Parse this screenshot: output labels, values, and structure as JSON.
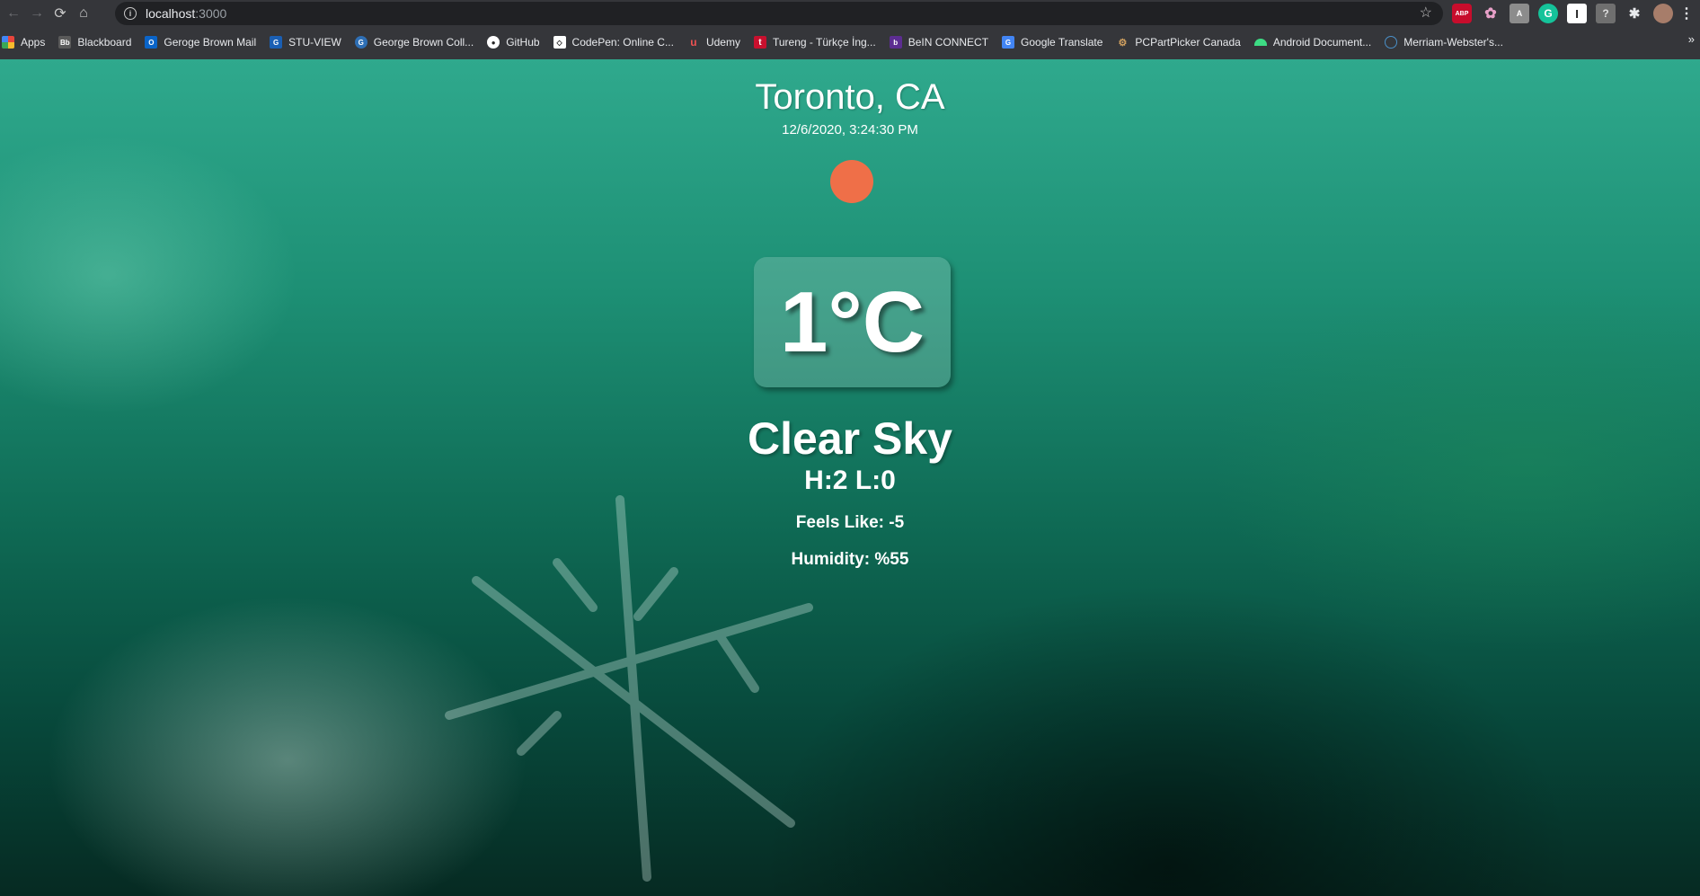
{
  "browser": {
    "url_host": "localhost",
    "url_port": ":3000",
    "bookmarks": [
      {
        "label": "Apps",
        "icon": "apps-grid-icon",
        "color": "#e8453c"
      },
      {
        "label": "Blackboard",
        "icon": "blackboard-icon",
        "color": "#5a5a5a"
      },
      {
        "label": "Geroge Brown Mail",
        "icon": "outlook-icon",
        "color": "#0a64c8"
      },
      {
        "label": "STU-VIEW",
        "icon": "gbc-icon",
        "color": "#1a5fb4"
      },
      {
        "label": "George Brown Coll...",
        "icon": "gbc-circle-icon",
        "color": "#2e6fb5"
      },
      {
        "label": "GitHub",
        "icon": "github-icon",
        "color": "#ffffff"
      },
      {
        "label": "CodePen: Online C...",
        "icon": "codepen-icon",
        "color": "#ffffff"
      },
      {
        "label": "Udemy",
        "icon": "udemy-icon",
        "color": "#ec5252"
      },
      {
        "label": "Tureng - Türkçe İng...",
        "icon": "tureng-icon",
        "color": "#c8102e"
      },
      {
        "label": "BeIN CONNECT",
        "icon": "bein-icon",
        "color": "#5c2d91"
      },
      {
        "label": "Google Translate",
        "icon": "google-translate-icon",
        "color": "#4285f4"
      },
      {
        "label": "PCPartPicker Canada",
        "icon": "pcpartpicker-icon",
        "color": "#d0a060"
      },
      {
        "label": "Android Document...",
        "icon": "android-icon",
        "color": "#3ddc84"
      },
      {
        "label": "Merriam-Webster's...",
        "icon": "globe-icon",
        "color": "#4a90c8"
      }
    ]
  },
  "weather": {
    "city": "Toronto, CA",
    "datetime": "12/6/2020, 3:24:30 PM",
    "icon": "sun-icon",
    "sun_color": "#ef6f48",
    "temperature": "1°C",
    "description": "Clear Sky",
    "high_low": "H:2 L:0",
    "feels_like": "Feels Like: -5",
    "humidity": "Humidity: %55"
  }
}
